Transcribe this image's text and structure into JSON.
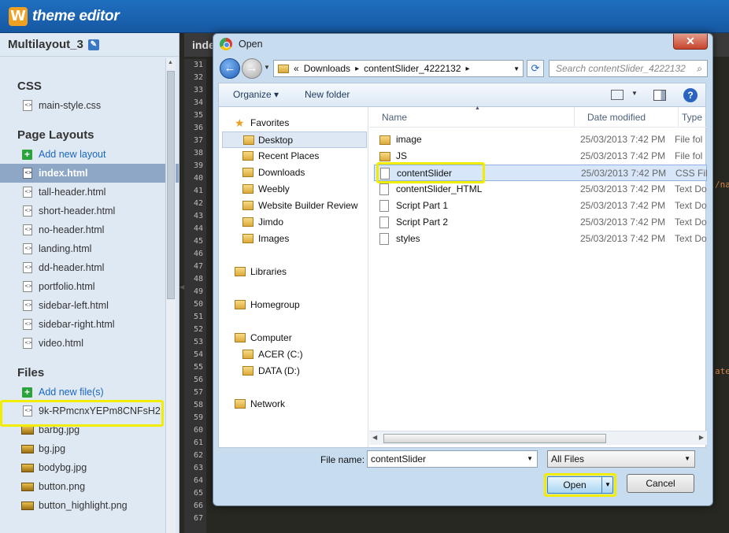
{
  "app": {
    "logo_letter": "W",
    "title": "theme editor"
  },
  "sidebar": {
    "site_name": "Multilayout_3",
    "css_heading": "CSS",
    "css_files": [
      "main-style.css"
    ],
    "layouts_heading": "Page Layouts",
    "add_layout": "Add new layout",
    "layouts": [
      "index.html",
      "tall-header.html",
      "short-header.html",
      "no-header.html",
      "landing.html",
      "dd-header.html",
      "portfolio.html",
      "sidebar-left.html",
      "sidebar-right.html",
      "video.html"
    ],
    "selected_layout": "index.html",
    "files_heading": "Files",
    "add_files": "Add new file(s)",
    "files": [
      "9k-RPmcnxYEPm8CNFsH2",
      "barbg.jpg",
      "bg.jpg",
      "bodybg.jpg",
      "button.png",
      "button_highlight.png"
    ]
  },
  "editor": {
    "tab": "inde",
    "line_numbers": [
      "31",
      "32",
      "33",
      "34",
      "35",
      "36",
      "37",
      "38",
      "39",
      "40",
      "41",
      "42",
      "43",
      "44",
      "45",
      "46",
      "47",
      "48",
      "49",
      "50",
      "51",
      "52",
      "53",
      "54",
      "55",
      "56",
      "57",
      "58",
      "59",
      "60",
      "61",
      "62",
      "63",
      "64",
      "65",
      "66",
      "67"
    ],
    "fragment_1": "/na",
    "fragment_2": "ate"
  },
  "dialog": {
    "title": "Open",
    "close": "✕",
    "address": {
      "prefix": "«",
      "crumbs": [
        "Downloads",
        "contentSlider_4222132"
      ]
    },
    "search_placeholder": "Search contentSlider_4222132",
    "toolbar": {
      "organize": "Organize ▾",
      "new_folder": "New folder",
      "help": "?"
    },
    "nav": {
      "favorites": "Favorites",
      "favorites_items": [
        "Desktop",
        "Recent Places",
        "Downloads",
        "Weebly",
        "Website Builder Review",
        "Jimdo",
        "Images"
      ],
      "libraries": "Libraries",
      "homegroup": "Homegroup",
      "computer": "Computer",
      "drives": [
        "ACER (C:)",
        "DATA (D:)"
      ],
      "network": "Network"
    },
    "columns": {
      "name": "Name",
      "date": "Date modified",
      "type": "Type"
    },
    "files": [
      {
        "name": "image",
        "date": "25/03/2013 7:42 PM",
        "type": "File fol",
        "kind": "folder"
      },
      {
        "name": "JS",
        "date": "25/03/2013 7:42 PM",
        "type": "File fol",
        "kind": "folder"
      },
      {
        "name": "contentSlider",
        "date": "25/03/2013 7:42 PM",
        "type": "CSS Fil",
        "kind": "doc"
      },
      {
        "name": "contentSlider_HTML",
        "date": "25/03/2013 7:42 PM",
        "type": "Text Do",
        "kind": "doc"
      },
      {
        "name": "Script Part 1",
        "date": "25/03/2013 7:42 PM",
        "type": "Text Do",
        "kind": "doc"
      },
      {
        "name": "Script Part 2",
        "date": "25/03/2013 7:42 PM",
        "type": "Text Do",
        "kind": "doc"
      },
      {
        "name": "styles",
        "date": "25/03/2013 7:42 PM",
        "type": "Text Do",
        "kind": "doc"
      }
    ],
    "selected_file": "contentSlider",
    "filename_label": "File name:",
    "filename_value": "contentSlider",
    "filetype_value": "All Files",
    "open_label": "Open",
    "cancel_label": "Cancel"
  },
  "colors": {
    "highlight": "#f2ec00",
    "topbar": "#1a63b4",
    "editor_bg": "#272822"
  }
}
